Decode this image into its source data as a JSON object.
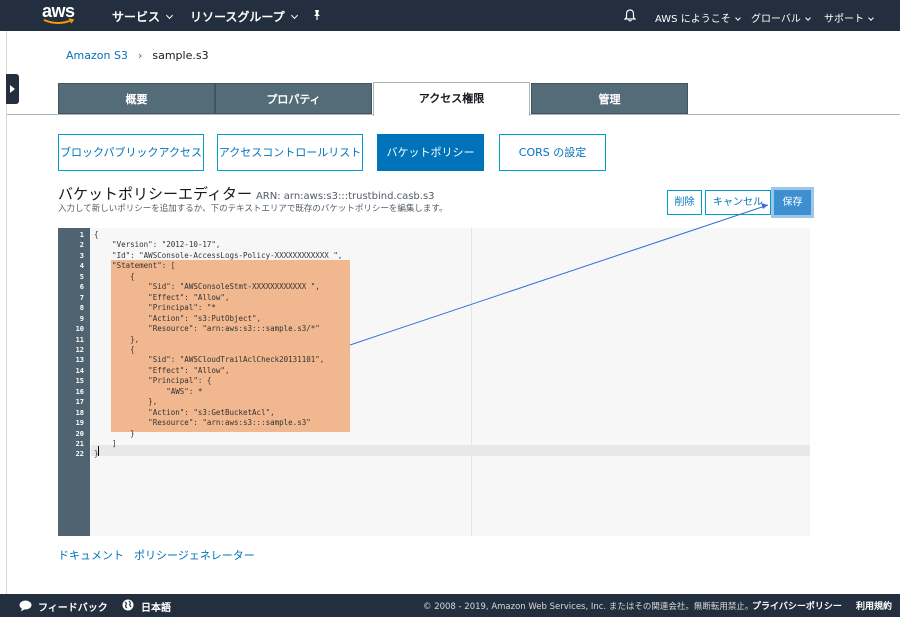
{
  "nav": {
    "logo": "aws",
    "services": "サービス",
    "resource_groups": "リソースグループ",
    "welcome": "AWS にようこそ",
    "region": "グローバル",
    "support": "サポート"
  },
  "breadcrumb": {
    "root": "Amazon S3",
    "separator": "›",
    "current": "sample.s3"
  },
  "tabs": [
    {
      "label": "概要",
      "active": false
    },
    {
      "label": "プロパティ",
      "active": false
    },
    {
      "label": "アクセス権限",
      "active": true
    },
    {
      "label": "管理",
      "active": false
    }
  ],
  "subtabs": [
    {
      "label": "ブロックパブリックアクセス",
      "selected": false
    },
    {
      "label": "アクセスコントロールリスト",
      "selected": false
    },
    {
      "label": "バケットポリシー",
      "selected": true
    },
    {
      "label": "CORS の設定",
      "selected": false
    }
  ],
  "editor": {
    "title": "バケットポリシーエディター",
    "arn": "ARN: arn:aws:s3:::trustbind.casb.s3",
    "description": "入力して新しいポリシーを追加するか、下のテキストエリアで既存のバケットポリシーを編集します。",
    "delete_label": "削除",
    "cancel_label": "キャンセル",
    "save_label": "保存",
    "line_numbers": [
      "1",
      "2",
      "3",
      "4",
      "5",
      "6",
      "7",
      "8",
      "9",
      "10",
      "11",
      "12",
      "13",
      "14",
      "15",
      "16",
      "17",
      "18",
      "19",
      "20",
      "21",
      "22"
    ],
    "lines": [
      "{",
      "    \"Version\": \"2012-10-17\",",
      "    \"Id\": \"AWSConsole-AccessLogs-Policy-XXXXXXXXXXXX \",",
      "    \"Statement\": [",
      "        {",
      "            \"Sid\": \"AWSConsoleStmt-XXXXXXXXXXXX \",",
      "            \"Effect\": \"Allow\",",
      "            \"Principal\": \"*",
      "            \"Action\": \"s3:PutObject\",",
      "            \"Resource\": \"arn:aws:s3:::sample.s3/*\"",
      "        },",
      "        {",
      "            \"Sid\": \"AWSCloudTrailAclCheck20131101\",",
      "            \"Effect\": \"Allow\",",
      "            \"Principal\": {",
      "                \"AWS\": *",
      "            },",
      "            \"Action\": \"s3:GetBucketAcl\",",
      "            \"Resource\": \"arn:aws:s3:::sample.s3\"",
      "        }",
      "    ]",
      "}"
    ]
  },
  "bottom_links": {
    "docs": "ドキュメント",
    "policy_generator": "ポリシージェネレーター"
  },
  "footer": {
    "feedback": "フィードバック",
    "language": "日本語",
    "copyright": "© 2008 - 2019, Amazon Web Services, Inc. またはその関連会社。無断転用禁止。",
    "privacy": "プライバシーポリシー",
    "terms": "利用規約"
  },
  "colors": {
    "nav_bg": "#232f3e",
    "accent": "#0073bb",
    "tab_inactive": "#546b78",
    "highlight": "#f0b48a",
    "save_button": "#3e8fd0"
  }
}
